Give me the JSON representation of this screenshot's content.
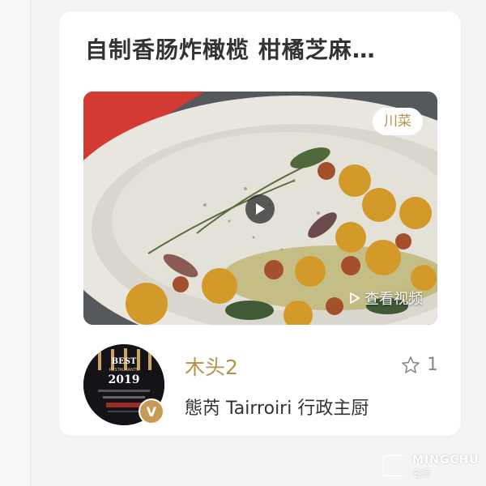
{
  "card": {
    "title": "自制香肠炸橄榄 柑橘芝麻…",
    "category_tag": "川菜",
    "view_video_label": "查看视频",
    "play_icon": "play-icon"
  },
  "author": {
    "name": "木头2",
    "title": "態芮 Tairroiri 行政主厨",
    "verified_badge": "V",
    "like_count": "1",
    "like_icon": "star-outline-icon"
  },
  "avatar_text": {
    "year": "2019",
    "line1": "BEST",
    "line2": "RESTAURANTS"
  },
  "watermark": {
    "en": "MINGCHU",
    "cn": "名厨"
  },
  "colors": {
    "accent_gold": "#b5934a",
    "badge_gold": "#c89a55",
    "title_text": "#333333"
  }
}
